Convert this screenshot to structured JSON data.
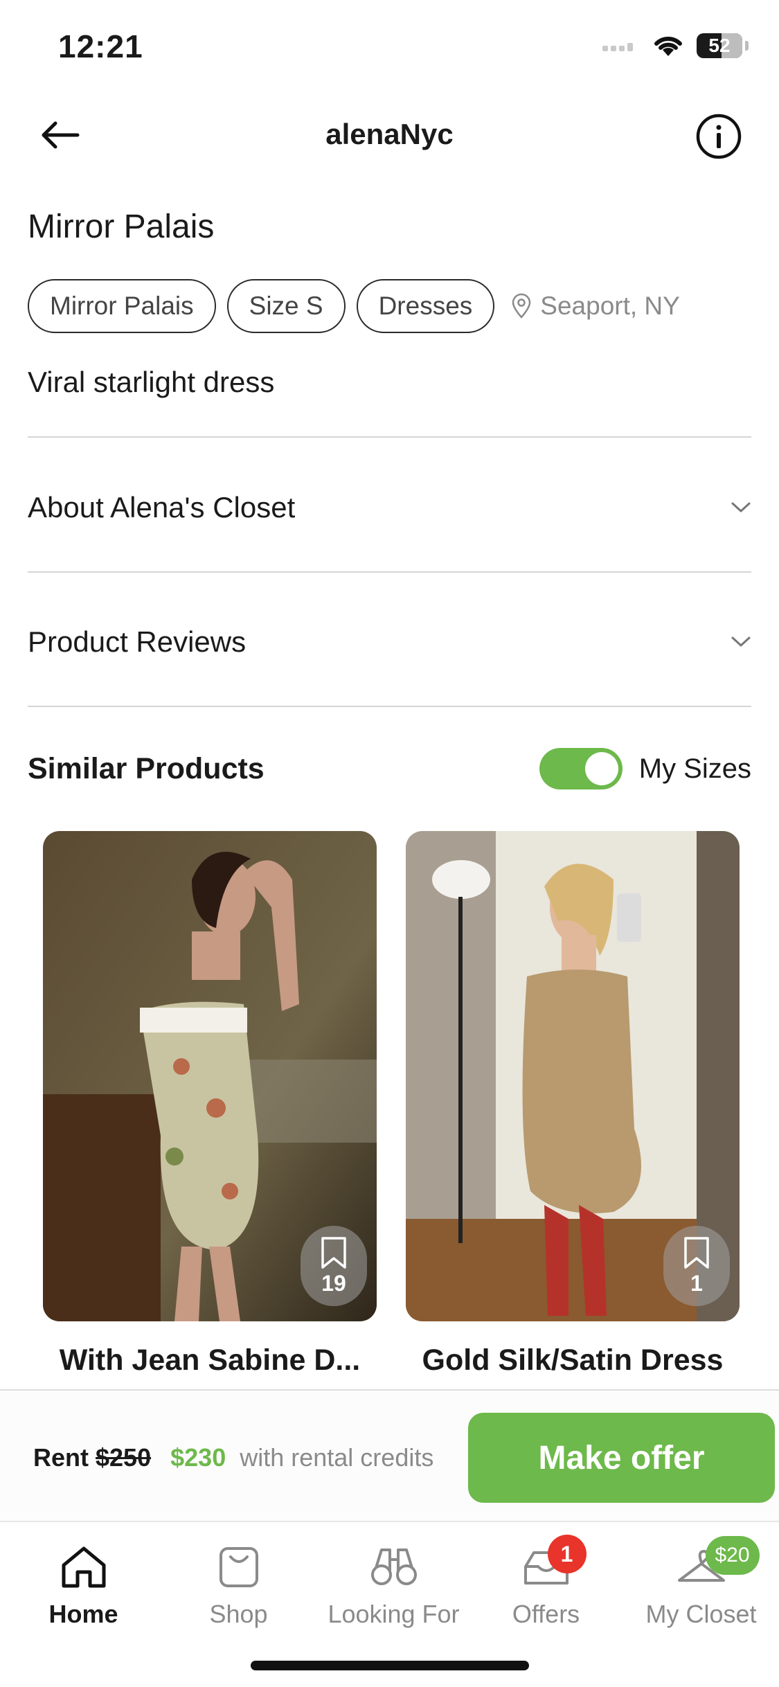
{
  "status_bar": {
    "time": "12:21",
    "battery": "52"
  },
  "header": {
    "title": "alenaNyc"
  },
  "product": {
    "title": "Mirror Palais",
    "chips": [
      "Mirror Palais",
      "Size S",
      "Dresses"
    ],
    "location": "Seaport, NY",
    "description": "Viral starlight dress"
  },
  "accordions": [
    {
      "label": "About Alena's Closet"
    },
    {
      "label": "Product Reviews"
    }
  ],
  "similar": {
    "title": "Similar Products",
    "toggle_label": "My Sizes",
    "toggle_on": true,
    "cards": [
      {
        "name": "With Jean Sabine D...",
        "saves": "19"
      },
      {
        "name": "Gold Silk/Satin Dress",
        "saves": "1"
      }
    ]
  },
  "price_bar": {
    "rent_label": "Rent",
    "original_price": "$250",
    "credit_price": "$230",
    "credit_note": "with rental credits",
    "offer_button": "Make offer"
  },
  "tabs": [
    {
      "label": "Home",
      "icon": "home-icon",
      "active": true
    },
    {
      "label": "Shop",
      "icon": "shopping-bag-icon"
    },
    {
      "label": "Looking For",
      "icon": "binoculars-icon"
    },
    {
      "label": "Offers",
      "icon": "inbox-icon",
      "badge": "1"
    },
    {
      "label": "My Closet",
      "icon": "hanger-icon",
      "badge": "$20"
    }
  ],
  "colors": {
    "accent": "#6db94b",
    "badge_red": "#e8342a",
    "muted": "#8a8a8a"
  }
}
